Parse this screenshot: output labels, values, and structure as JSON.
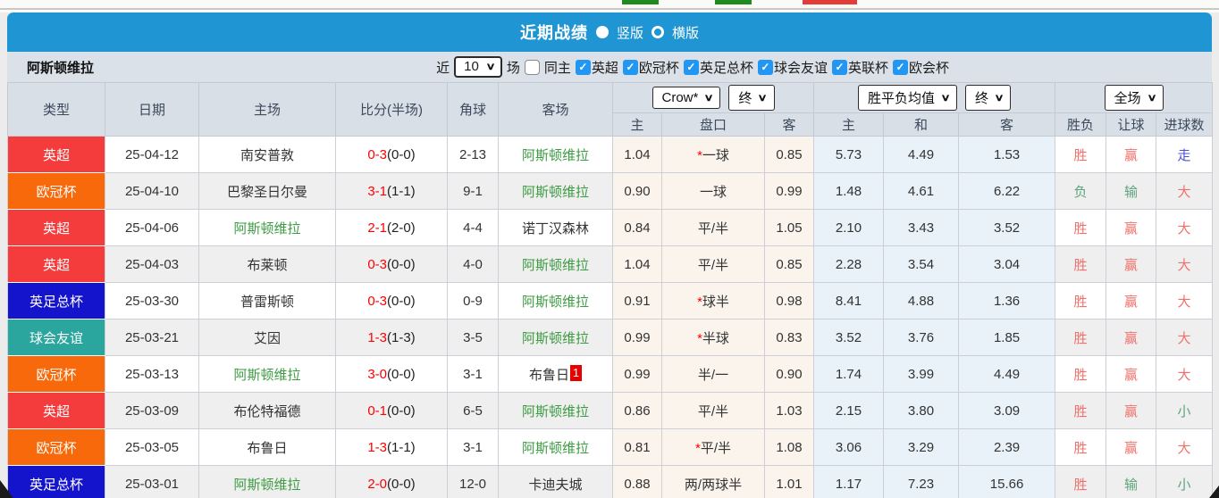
{
  "icons": {
    "chevron_down": "∨",
    "check": "✓"
  },
  "header_bar": {
    "title": "近期战绩",
    "view_modes": [
      {
        "label": "竖版",
        "selected": true
      },
      {
        "label": "横版",
        "selected": false
      }
    ]
  },
  "filter": {
    "team": "阿斯顿维拉",
    "recent_label": "近",
    "count_value": "10",
    "unit_label": "场",
    "same_home": {
      "label": "同主",
      "checked": false
    },
    "competitions": [
      {
        "label": "英超",
        "checked": true
      },
      {
        "label": "欧冠杯",
        "checked": true
      },
      {
        "label": "英足总杯",
        "checked": true
      },
      {
        "label": "球会友谊",
        "checked": true
      },
      {
        "label": "英联杯",
        "checked": true
      },
      {
        "label": "欧会杯",
        "checked": true
      }
    ]
  },
  "table": {
    "dropdowns": {
      "company": "Crow*",
      "company_state": "终",
      "avg": "胜平负均值",
      "avg_state": "终",
      "scope": "全场"
    },
    "columns": {
      "type": "类型",
      "date": "日期",
      "home": "主场",
      "score": "比分(半场)",
      "corners": "角球",
      "away": "客场",
      "odds_home": "主",
      "odds_line": "盘口",
      "odds_away": "客",
      "avg_home": "主",
      "avg_draw": "和",
      "avg_away": "客",
      "result": "胜负",
      "handicap": "让球",
      "goals": "进球数"
    },
    "rows": [
      {
        "type": "英超",
        "date": "25-04-12",
        "home": "南安普敦",
        "score": "0-3",
        "half": "(0-0)",
        "corners": "2-13",
        "away": "阿斯顿维拉",
        "odds_home": "1.04",
        "line_star": "*",
        "line": "一球",
        "odds_away": "0.85",
        "avg_home": "5.73",
        "avg_draw": "4.49",
        "avg_away": "1.53",
        "result": "胜",
        "handicap": "赢",
        "goals": "走"
      },
      {
        "type": "欧冠杯",
        "date": "25-04-10",
        "home": "巴黎圣日尔曼",
        "score": "3-1",
        "half": "(1-1)",
        "corners": "9-1",
        "away": "阿斯顿维拉",
        "odds_home": "0.90",
        "line": "一球",
        "odds_away": "0.99",
        "avg_home": "1.48",
        "avg_draw": "4.61",
        "avg_away": "6.22",
        "result": "负",
        "handicap": "输",
        "goals": "大"
      },
      {
        "type": "英超",
        "date": "25-04-06",
        "home": "阿斯顿维拉",
        "score": "2-1",
        "half": "(2-0)",
        "corners": "4-4",
        "away": "诺丁汉森林",
        "odds_home": "0.84",
        "line": "平/半",
        "odds_away": "1.05",
        "avg_home": "2.10",
        "avg_draw": "3.43",
        "avg_away": "3.52",
        "result": "胜",
        "handicap": "赢",
        "goals": "大"
      },
      {
        "type": "英超",
        "date": "25-04-03",
        "home": "布莱顿",
        "score": "0-3",
        "half": "(0-0)",
        "corners": "4-0",
        "away": "阿斯顿维拉",
        "odds_home": "1.04",
        "line": "平/半",
        "odds_away": "0.85",
        "avg_home": "2.28",
        "avg_draw": "3.54",
        "avg_away": "3.04",
        "result": "胜",
        "handicap": "赢",
        "goals": "大"
      },
      {
        "type": "英足总杯",
        "date": "25-03-30",
        "home": "普雷斯顿",
        "score": "0-3",
        "half": "(0-0)",
        "corners": "0-9",
        "away": "阿斯顿维拉",
        "odds_home": "0.91",
        "line_star": "*",
        "line": "球半",
        "odds_away": "0.98",
        "avg_home": "8.41",
        "avg_draw": "4.88",
        "avg_away": "1.36",
        "result": "胜",
        "handicap": "赢",
        "goals": "大"
      },
      {
        "type": "球会友谊",
        "date": "25-03-21",
        "home": "艾因",
        "score": "1-3",
        "half": "(1-3)",
        "corners": "3-5",
        "away": "阿斯顿维拉",
        "odds_home": "0.99",
        "line_star": "*",
        "line": "半球",
        "odds_away": "0.83",
        "avg_home": "3.52",
        "avg_draw": "3.76",
        "avg_away": "1.85",
        "result": "胜",
        "handicap": "赢",
        "goals": "大"
      },
      {
        "type": "欧冠杯",
        "date": "25-03-13",
        "home": "阿斯顿维拉",
        "score": "3-0",
        "half": "(0-0)",
        "corners": "3-1",
        "away": "布鲁日",
        "away_badge": "1",
        "odds_home": "0.99",
        "line": "半/一",
        "odds_away": "0.90",
        "avg_home": "1.74",
        "avg_draw": "3.99",
        "avg_away": "4.49",
        "result": "胜",
        "handicap": "赢",
        "goals": "大"
      },
      {
        "type": "英超",
        "date": "25-03-09",
        "home": "布伦特福德",
        "score": "0-1",
        "half": "(0-0)",
        "corners": "6-5",
        "away": "阿斯顿维拉",
        "odds_home": "0.86",
        "line": "平/半",
        "odds_away": "1.03",
        "avg_home": "2.15",
        "avg_draw": "3.80",
        "avg_away": "3.09",
        "result": "胜",
        "handicap": "赢",
        "goals": "小"
      },
      {
        "type": "欧冠杯",
        "date": "25-03-05",
        "home": "布鲁日",
        "score": "1-3",
        "half": "(1-1)",
        "corners": "3-1",
        "away": "阿斯顿维拉",
        "odds_home": "0.81",
        "line_star": "*",
        "line": "平/半",
        "odds_away": "1.08",
        "avg_home": "3.06",
        "avg_draw": "3.29",
        "avg_away": "2.39",
        "result": "胜",
        "handicap": "赢",
        "goals": "大"
      },
      {
        "type": "英足总杯",
        "date": "25-03-01",
        "home": "阿斯顿维拉",
        "score": "2-0",
        "half": "(0-0)",
        "corners": "12-0",
        "away": "卡迪夫城",
        "odds_home": "0.88",
        "line": "两/两球半",
        "odds_away": "1.01",
        "avg_home": "1.17",
        "avg_draw": "7.23",
        "avg_away": "15.66",
        "result": "胜",
        "handicap": "输",
        "goals": "小"
      }
    ]
  },
  "colors": {
    "accent_blue": "#2095d3",
    "badge_epl": "#f43c3c",
    "badge_ucl": "#f7690a",
    "badge_fa_cup": "#1414cc",
    "badge_friendly": "#2aa69e",
    "win_red": "#f0716b",
    "lose_green": "#5da47c",
    "walk_blue": "#4b50d8",
    "score_red": "#ff0000",
    "team_green": "#3c9b42",
    "checkbox_blue": "#2196f3"
  }
}
